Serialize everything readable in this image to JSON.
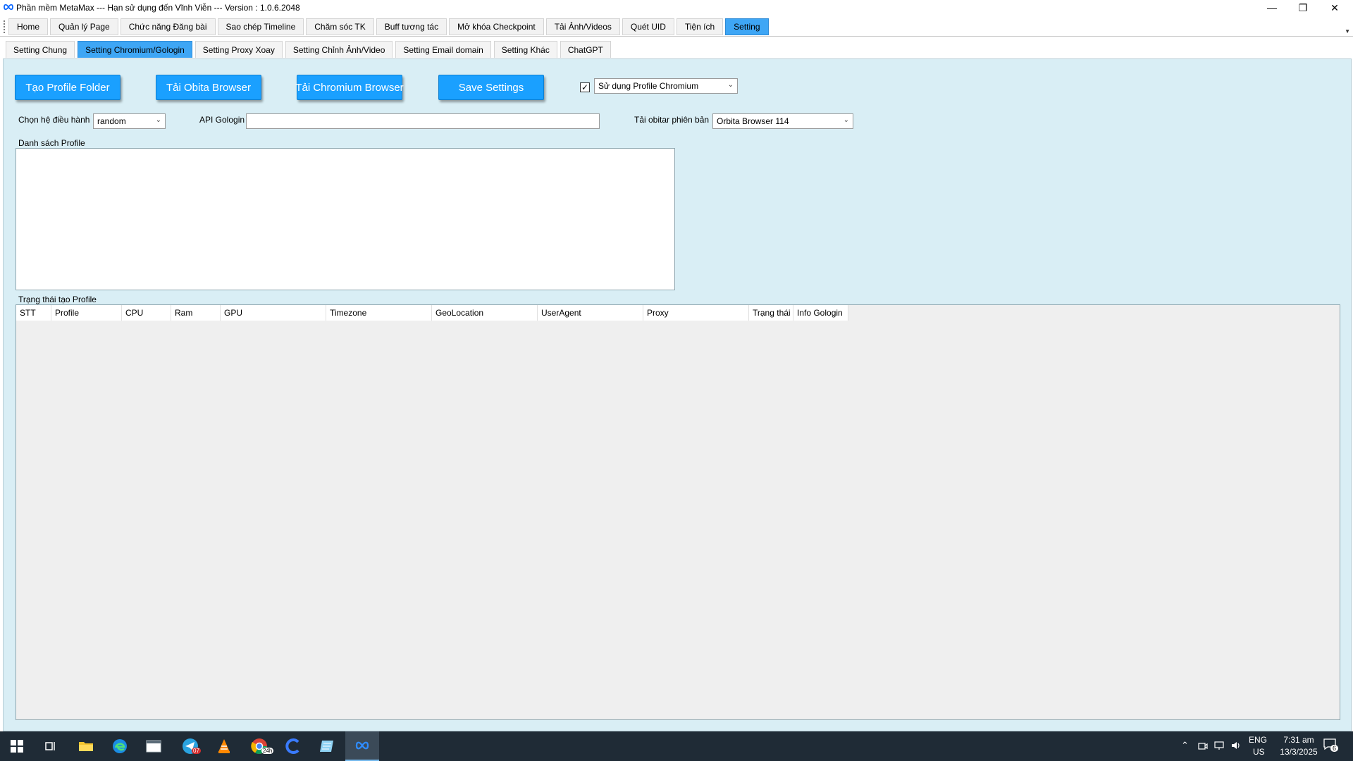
{
  "window": {
    "title": "Phần mềm MetaMax --- Hạn sử dụng đến Vĩnh Viễn --- Version : 1.0.6.2048",
    "minimize": "—",
    "restore": "❐",
    "close": "✕"
  },
  "main_tabs": [
    {
      "label": "Home"
    },
    {
      "label": "Quản lý Page"
    },
    {
      "label": "Chức năng Đăng bài"
    },
    {
      "label": "Sao chép Timeline"
    },
    {
      "label": "Chăm sóc TK"
    },
    {
      "label": "Buff tương tác"
    },
    {
      "label": "Mở khóa Checkpoint"
    },
    {
      "label": "Tải Ảnh/Videos"
    },
    {
      "label": "Quét UID"
    },
    {
      "label": "Tiện ích"
    },
    {
      "label": "Setting",
      "active": true
    }
  ],
  "sub_tabs": [
    {
      "label": "Setting Chung"
    },
    {
      "label": "Setting Chromium/Gologin",
      "active": true
    },
    {
      "label": "Setting Proxy Xoay"
    },
    {
      "label": "Setting Chỉnh Ảnh/Video"
    },
    {
      "label": "Setting Email domain"
    },
    {
      "label": "Setting Khác"
    },
    {
      "label": "ChatGPT"
    }
  ],
  "buttons": {
    "create_profile_folder": "Tạo Profile Folder",
    "download_obita": "Tải Obita Browser",
    "download_chromium": "Tải Chromium Browser",
    "save_settings": "Save Settings"
  },
  "use_profile": {
    "checked": true,
    "check_mark": "✓",
    "value": "Sử dụng Profile Chromium"
  },
  "os_select": {
    "label": "Chọn hệ điều hành",
    "value": "random"
  },
  "api_gologin": {
    "label": "API Gologin",
    "value": ""
  },
  "orbita_version": {
    "label": "Tải obitar phiên bản",
    "value": "Orbita Browser 114"
  },
  "profile_list": {
    "label": "Danh sách Profile"
  },
  "status_grid": {
    "label": "Trạng thái tạo Profile",
    "columns": [
      "STT",
      "Profile",
      "CPU",
      "Ram",
      "GPU",
      "Timezone",
      "GeoLocation",
      "UserAgent",
      "Proxy",
      "Trạng thái",
      "Info Gologin"
    ]
  },
  "taskbar": {
    "telegram_badge": "07",
    "chrome_badge": "24h",
    "lang_top": "ENG",
    "lang_bottom": "US",
    "time": "7:31 am",
    "date": "13/3/2025",
    "notification_count": "6"
  },
  "colors": {
    "accent": "#3ea6f5",
    "button": "#1aa0ff",
    "panel": "#d9eef5",
    "taskbar": "#1f2b36"
  }
}
